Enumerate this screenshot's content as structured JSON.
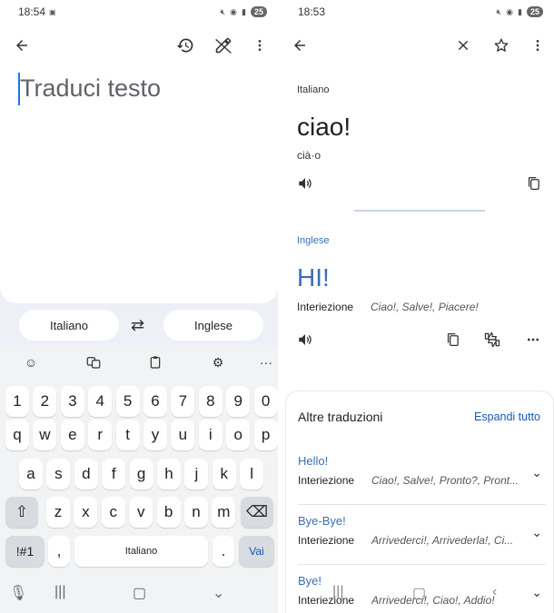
{
  "left": {
    "status": {
      "time": "18:54",
      "battery": "25"
    },
    "placeholder": "Traduci testo",
    "source_lang": "Italiano",
    "target_lang": "Inglese",
    "keyboard": {
      "row1": [
        "1",
        "2",
        "3",
        "4",
        "5",
        "6",
        "7",
        "8",
        "9",
        "0"
      ],
      "row2": [
        "q",
        "w",
        "e",
        "r",
        "t",
        "y",
        "u",
        "i",
        "o",
        "p"
      ],
      "row3": [
        "a",
        "s",
        "d",
        "f",
        "g",
        "h",
        "j",
        "k",
        "l"
      ],
      "row4": [
        "z",
        "x",
        "c",
        "v",
        "b",
        "n",
        "m"
      ],
      "symbols_key": "!#1",
      "comma_key": ",",
      "space_label": "Italiano",
      "period_key": ".",
      "action_key": "Vai"
    }
  },
  "right": {
    "status": {
      "time": "18:53",
      "battery": "25"
    },
    "source_lang_label": "Italiano",
    "source_word": "ciao!",
    "phonetic": "cià·o",
    "target_lang_label": "Inglese",
    "translation": "HI!",
    "part_of_speech": "Interiezione",
    "synonyms": "Ciao!, Salve!, Piacere!",
    "other_translations": {
      "title": "Altre traduzioni",
      "expand_label": "Espandi tutto",
      "items": [
        {
          "word": "Hello!",
          "pos": "Interiezione",
          "synonyms": "Ciao!, Salve!, Pronto?, Pront..."
        },
        {
          "word": "Bye-Bye!",
          "pos": "Interiezione",
          "synonyms": "Arrivederci!, Arrivederla!, Ci..."
        },
        {
          "word": "Bye!",
          "pos": "Interiezione",
          "synonyms": "Arrivederci!, Ciao!, Addio!"
        }
      ]
    }
  }
}
